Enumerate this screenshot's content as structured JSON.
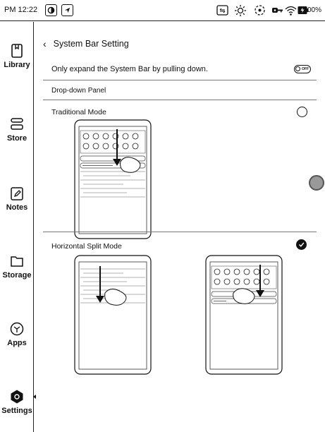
{
  "status_bar": {
    "time": "PM 12:22",
    "battery": "100%",
    "icons": [
      "screenshot-icon",
      "brightness-icon",
      "sync-icon",
      "key-icon",
      "wifi-icon",
      "battery-charging-icon"
    ]
  },
  "sidebar": {
    "items": [
      {
        "label": "Library",
        "icon": "library-icon"
      },
      {
        "label": "Store",
        "icon": "store-icon"
      },
      {
        "label": "Notes",
        "icon": "notes-icon"
      },
      {
        "label": "Storage",
        "icon": "storage-icon"
      },
      {
        "label": "Apps",
        "icon": "apps-icon"
      },
      {
        "label": "Settings",
        "icon": "settings-icon",
        "active": true
      }
    ]
  },
  "main": {
    "title": "System Bar Setting",
    "expand_option": {
      "label": "Only expand the System Bar by pulling down.",
      "toggle_text": "OFF"
    },
    "section_label": "Drop-down Panel",
    "modes": [
      {
        "label": "Traditional Mode",
        "selected": false
      },
      {
        "label": "Horizontal Split Mode",
        "selected": true
      }
    ]
  }
}
